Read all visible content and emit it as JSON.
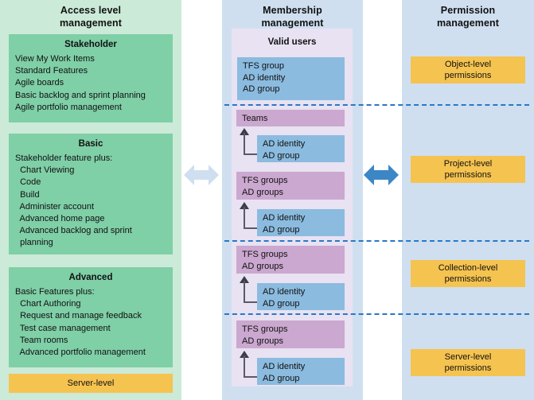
{
  "columns": {
    "access": {
      "title": "Access level\nmanagement",
      "cards": [
        {
          "heading": "Stakeholder",
          "items": [
            "View My Work Items",
            "Standard Features",
            "Agile boards",
            "Basic backlog and sprint planning",
            "Agile portfolio management"
          ]
        },
        {
          "heading": "Basic",
          "items": [
            "Stakeholder feature plus:",
            "  Chart Viewing",
            "  Code",
            "  Build",
            "  Administer account",
            "  Advanced home page",
            "  Advanced backlog and sprint",
            "  planning"
          ]
        },
        {
          "heading": "Advanced",
          "items": [
            "Basic Features plus:",
            "  Chart Authoring",
            "  Request and manage feedback",
            "  Test case management",
            "  Team rooms",
            "  Advanced portfolio management"
          ]
        }
      ],
      "server_level_label": "Server-level"
    },
    "membership": {
      "title": "Membership\nmanagement",
      "panel_title": "Valid users",
      "groups": [
        {
          "primary": [
            "TFS group",
            "AD identity",
            "AD group"
          ],
          "child": null
        },
        {
          "primary": [
            "Teams"
          ],
          "child": [
            "AD identity",
            "AD group"
          ]
        },
        {
          "primary": [
            "TFS groups",
            "AD groups"
          ],
          "child": [
            "AD identity",
            "AD group"
          ]
        },
        {
          "primary": [
            "TFS groups",
            "AD groups"
          ],
          "child": [
            "AD identity",
            "AD group"
          ]
        },
        {
          "primary": [
            "TFS groups",
            "AD groups"
          ],
          "child": [
            "AD identity",
            "AD group"
          ]
        }
      ]
    },
    "permission": {
      "title": "Permission\nmanagement",
      "levels": [
        {
          "line1": "Object-level",
          "line2": "permissions"
        },
        {
          "line1": "Project-level",
          "line2": "permissions"
        },
        {
          "line1": "Collection-level",
          "line2": "permissions"
        },
        {
          "line1": "Server-level",
          "line2": "permissions"
        }
      ]
    }
  },
  "connectors": {
    "left_arrow": "double-arrow-horizontal-light",
    "right_arrow": "double-arrow-horizontal-blue"
  },
  "colors": {
    "left_column_bg": "#cbead8",
    "green_card": "#7fcfa7",
    "blue_column_bg": "#cfdff0",
    "lavender_panel": "#e8e2f2",
    "blue_box": "#8bbbdf",
    "purple_box": "#cba8cf",
    "yellow_box": "#f5c350",
    "dashed_line": "#2878c8",
    "arrow_blue": "#3d86c6",
    "arrow_light": "#cfdff0"
  }
}
